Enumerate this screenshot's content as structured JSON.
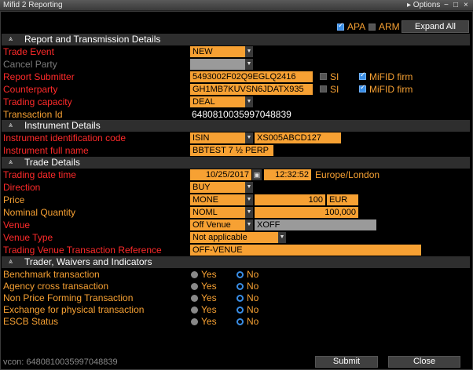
{
  "window": {
    "title": "Mifid 2 Reporting",
    "options_label": "▸ Options",
    "ctl_min": "−",
    "ctl_max": "□",
    "ctl_close": "×"
  },
  "topbar": {
    "apa_label": "APA",
    "apa_checked": true,
    "arm_label": "ARM",
    "arm_checked": false,
    "expand_all": "Expand All"
  },
  "sections": {
    "report": "Report and Transmission Details",
    "instrument": "Instrument Details",
    "trade": "Trade Details",
    "trader": "Trader, Waivers and Indicators"
  },
  "report": {
    "trade_event_label": "Trade Event",
    "trade_event_value": "NEW",
    "cancel_party_label": "Cancel Party",
    "cancel_party_value": "",
    "report_submitter_label": "Report Submitter",
    "report_submitter_value": "5493002F02Q9EGLQ2416",
    "counterparty_label": "Counterparty",
    "counterparty_value": "GH1MB7KUVSN6JDATX935",
    "si_label": "SI",
    "mifid_firm_label": "MiFID firm",
    "trading_capacity_label": "Trading capacity",
    "trading_capacity_value": "DEAL",
    "transaction_id_label": "Transaction Id",
    "transaction_id_value": "6480810035997048839"
  },
  "instrument": {
    "id_code_label": "Instrument identification code",
    "id_type": "ISIN",
    "id_value": "XS005ABCD127",
    "full_name_label": "Instrument full name",
    "full_name_value": "BBTEST 7 ½  PERP"
  },
  "trade": {
    "date_time_label": "Trading date time",
    "date_value": "10/25/2017",
    "time_value": "12:32:52",
    "tz": "Europe/London",
    "cal_icon": "▣",
    "direction_label": "Direction",
    "direction_value": "BUY",
    "price_label": "Price",
    "price_type": "MONE",
    "price_value": "100",
    "price_ccy": "EUR",
    "nominal_label": "Nominal Quantity",
    "nominal_type": "NOML",
    "nominal_value": "100,000",
    "venue_label": "Venue",
    "venue_value": "Off Venue",
    "venue_code": "XOFF",
    "venue_type_label": "Venue Type",
    "venue_type_value": "Not applicable",
    "tvtr_label": "Trading Venue Transaction Reference",
    "tvtr_value": "OFF-VENUE"
  },
  "indicators": [
    {
      "label": "Benchmark transaction",
      "yes": "Yes",
      "no": "No",
      "selected": "No"
    },
    {
      "label": "Agency cross transaction",
      "yes": "Yes",
      "no": "No",
      "selected": "No"
    },
    {
      "label": "Non Price Forming Transaction",
      "yes": "Yes",
      "no": "No",
      "selected": "No"
    },
    {
      "label": "Exchange for physical transaction",
      "yes": "Yes",
      "no": "No",
      "selected": "No"
    },
    {
      "label": "ESCB Status",
      "yes": "Yes",
      "no": "No",
      "selected": "No"
    }
  ],
  "footer": {
    "vcon": "vcon: 6480810035997048839",
    "submit": "Submit",
    "close": "Close"
  },
  "colors": {
    "accent": "#f7a133",
    "required": "#ff2a2a",
    "check": "#3a8ee6"
  }
}
